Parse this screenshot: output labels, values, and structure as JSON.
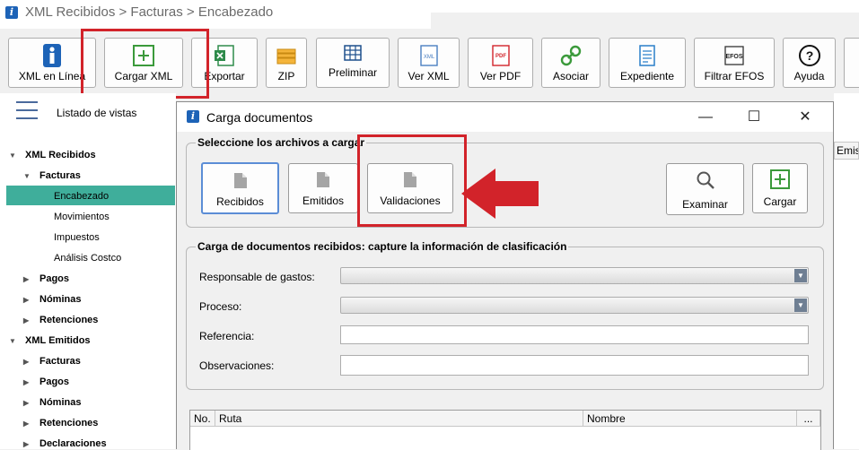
{
  "window": {
    "title": "XML Recibidos > Facturas > Encabezado"
  },
  "toolbar": {
    "buttons": [
      {
        "label": "XML en Línea"
      },
      {
        "label": "Cargar XML"
      },
      {
        "label": "Exportar"
      },
      {
        "label": "ZIP"
      },
      {
        "label": "Preliminar"
      },
      {
        "label": "Ver XML"
      },
      {
        "label": "Ver PDF"
      },
      {
        "label": "Asociar"
      },
      {
        "label": "Expediente"
      },
      {
        "label": "Filtrar EFOS"
      },
      {
        "label": "Ayuda"
      }
    ],
    "icon_text": {
      "xml": "XML",
      "pdf": "PDF",
      "efos": "EFOS",
      "help": "?"
    }
  },
  "sidebar": {
    "title": "Listado de vistas",
    "tree": [
      {
        "label": "XML Recibidos",
        "arrow": "▼"
      },
      {
        "label": "Facturas",
        "arrow": "▼"
      },
      {
        "label": "Encabezado"
      },
      {
        "label": "Movimientos"
      },
      {
        "label": "Impuestos"
      },
      {
        "label": "Análisis Costco"
      },
      {
        "label": "Pagos",
        "arrow": "▶"
      },
      {
        "label": "Nóminas",
        "arrow": "▶"
      },
      {
        "label": "Retenciones",
        "arrow": "▶"
      },
      {
        "label": "XML Emitidos",
        "arrow": "▼"
      },
      {
        "label": "Facturas",
        "arrow": "▶"
      },
      {
        "label": "Pagos",
        "arrow": "▶"
      },
      {
        "label": "Nóminas",
        "arrow": "▶"
      },
      {
        "label": "Retenciones",
        "arrow": "▶"
      },
      {
        "label": "Declaraciones",
        "arrow": "▶"
      }
    ]
  },
  "right_pane": {
    "partial_header": "Emis"
  },
  "dialog": {
    "title": "Carga documentos",
    "controls": {
      "minimize": "—",
      "maximize": "☐",
      "close": "✕"
    },
    "select_group": {
      "legend": "Seleccione los archivos a cargar",
      "buttons": {
        "recibidos": "Recibidos",
        "emitidos": "Emitidos",
        "validaciones": "Validaciones",
        "examinar": "Examinar",
        "cargar": "Cargar"
      }
    },
    "capture_group": {
      "legend": "Carga de documentos recibidos: capture la información de clasificación",
      "fields": {
        "responsable": {
          "label": "Responsable de gastos:",
          "value": ""
        },
        "proceso": {
          "label": "Proceso:",
          "value": ""
        },
        "referencia": {
          "label": "Referencia:",
          "value": ""
        },
        "observaciones": {
          "label": "Observaciones:",
          "value": ""
        }
      }
    },
    "grid": {
      "columns": [
        "No.",
        "Ruta",
        "Nombre",
        "..."
      ]
    }
  },
  "colors": {
    "selection": "#3fae9b",
    "annotation_red": "#d2232a",
    "brand_blue": "#1d63b7"
  }
}
